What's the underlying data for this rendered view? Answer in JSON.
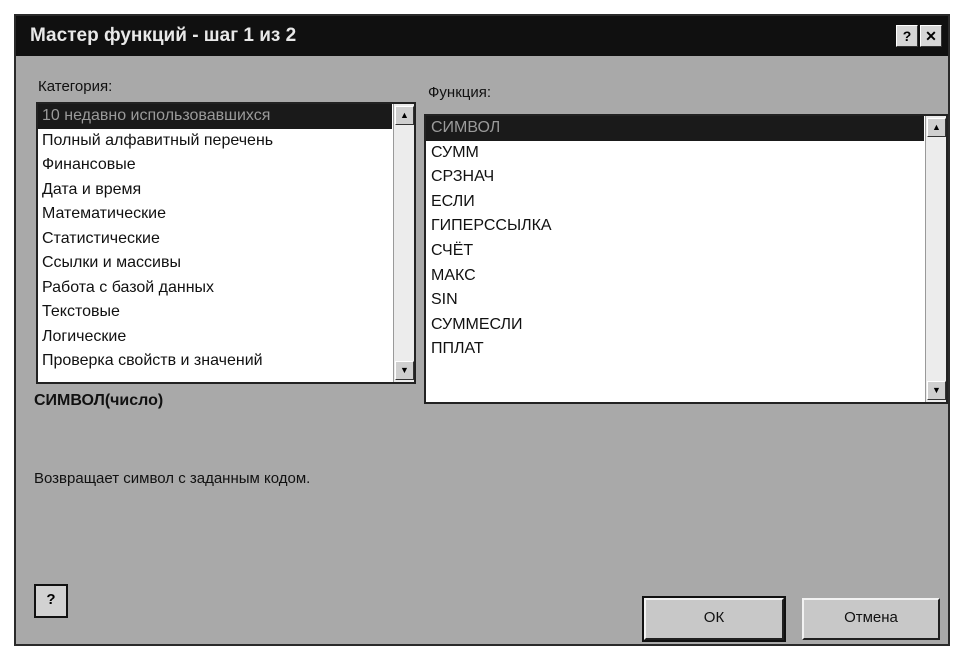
{
  "window": {
    "title": "Мастер функций - шаг 1 из 2",
    "help_glyph": "?",
    "close_glyph": "✕"
  },
  "categories": {
    "label": "Категория:",
    "items": [
      "10 недавно использовавшихся",
      "Полный алфавитный перечень",
      "Финансовые",
      "Дата и время",
      "Математические",
      "Статистические",
      "Ссылки и массивы",
      "Работа с базой данных",
      "Текстовые",
      "Логические",
      "Проверка свойств и значений"
    ],
    "selected_index": 0
  },
  "functions": {
    "label": "Функция:",
    "items": [
      "СИМВОЛ",
      "СУММ",
      "СРЗНАЧ",
      "ЕСЛИ",
      "ГИПЕРССЫЛКА",
      "СЧЁТ",
      "МАКС",
      "SIN",
      "СУММЕСЛИ",
      "ППЛАТ"
    ],
    "selected_index": 0
  },
  "syntax": "СИМВОЛ(число)",
  "description": "Возвращает символ с заданным кодом.",
  "help_button_glyph": "?",
  "buttons": {
    "ok": "ОК",
    "cancel": "Отмена"
  },
  "scroll_glyphs": {
    "up": "▲",
    "down": "▼"
  }
}
